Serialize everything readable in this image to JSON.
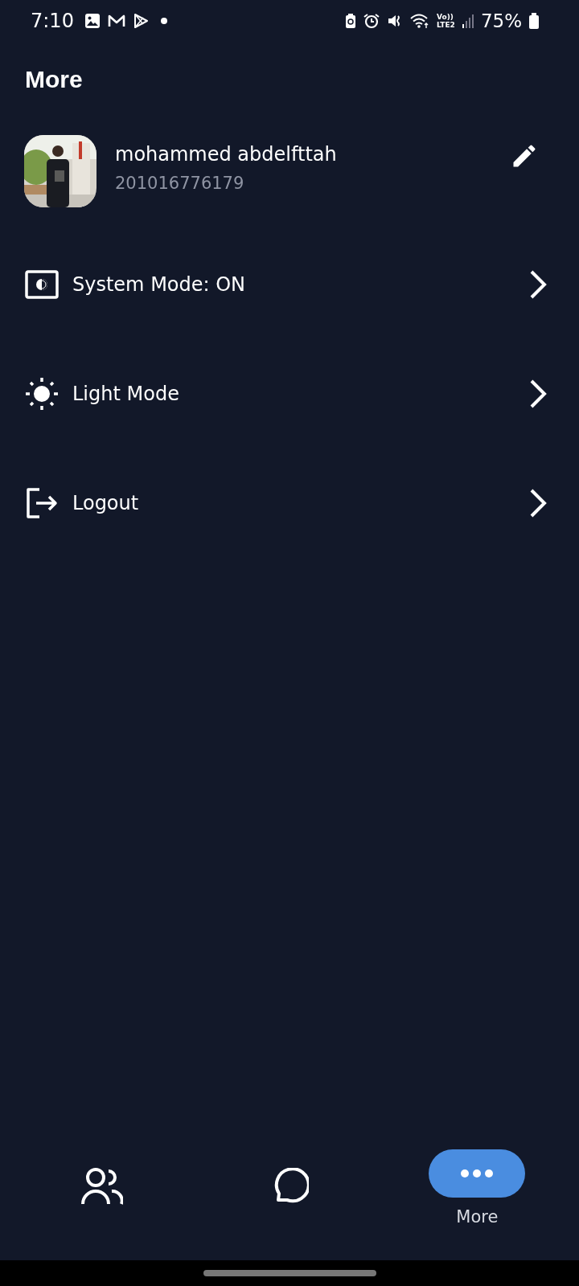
{
  "status_bar": {
    "time": "7:10",
    "network": "Vo))",
    "network_type": "LTE2",
    "battery": "75%"
  },
  "title": "More",
  "profile": {
    "name": "mohammed abdelfttah",
    "phone": "201016776179"
  },
  "menu": [
    {
      "kind": "system",
      "label": "System Mode: ON"
    },
    {
      "kind": "light",
      "label": "Light Mode"
    },
    {
      "kind": "logout",
      "label": "Logout"
    }
  ],
  "bottom_nav": [
    {
      "kind": "people",
      "selected": false
    },
    {
      "kind": "chat",
      "selected": false
    },
    {
      "kind": "more",
      "selected": true,
      "label": "More"
    }
  ]
}
